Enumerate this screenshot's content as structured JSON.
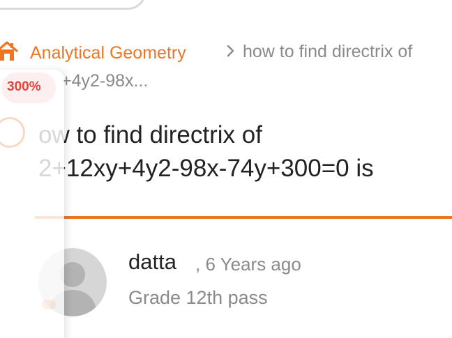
{
  "breadcrumb": {
    "home_icon": "home-icon",
    "category": "Analytical Geometry",
    "separator_icon": "chevron-right-icon",
    "current_line1": "how to find directrix of",
    "current_line2": "+4y2-98x..."
  },
  "question": {
    "title_line1": "ow to find directrix of",
    "title_line2": "2+12xy+4y2-98x-74y+300=0 is"
  },
  "author": {
    "name": "datta",
    "posted": ", 6 Years ago",
    "grade": "Grade 12th pass",
    "avatar_icon": "user-avatar-icon"
  },
  "widget": {
    "zoom_label": "300%"
  },
  "colors": {
    "accent": "#ee7623",
    "zoom_text": "#e0443b",
    "title_text": "#222222",
    "muted_text": "#8a8a8a"
  }
}
